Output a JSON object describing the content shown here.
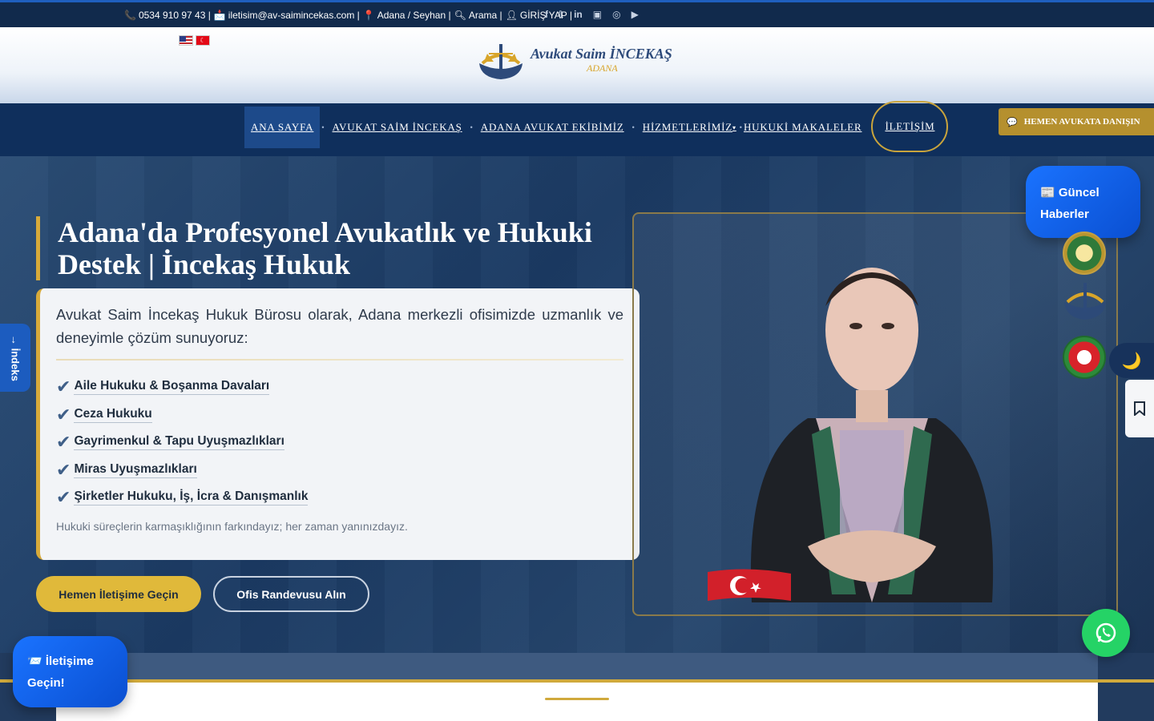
{
  "topbar": {
    "phone": "0534 910 97 43 |",
    "email": "iletisim@av-saimincekas.com |",
    "location": "Adana / Seyhan |",
    "search": "Arama |",
    "login": "GİRİŞ YAP |",
    "social_icons": [
      "facebook-icon",
      "twitter-icon",
      "linkedin-icon",
      "youtube-icon",
      "instagram-icon",
      "play-icon"
    ]
  },
  "header": {
    "logo_name": "Avukat Saim İNCEKAŞ",
    "logo_city": "ADANA",
    "languages": [
      "English",
      "Türkçe"
    ]
  },
  "nav": {
    "items": [
      "ANA SAYFA",
      "AVUKAT SAİM İNCEKAŞ",
      "ADANA AVUKAT EKİBİMİZ",
      "HİZMETLERİMİZ",
      "HUKUKİ MAKALELER",
      "İLETİŞİM"
    ],
    "consult_button": "HEMEN AVUKATA DANIŞIN"
  },
  "hero": {
    "title": "Adana'da Profesyonel Avukatlık ve Hukuki Destek | İncekaş Hukuk",
    "intro": "Avukat Saim İncekaş Hukuk Bürosu olarak, Adana merkezli ofisimizde uzmanlık ve deneyimle çözüm sunuyoruz:",
    "services": [
      "Aile Hukuku & Boşanma Davaları",
      "Ceza Hukuku",
      "Gayrimenkul & Tapu Uyuşmazlıkları",
      "Miras Uyuşmazlıkları",
      "Şirketler Hukuku, İş, İcra & Danışmanlık"
    ],
    "note": "Hukuki süreçlerin karmaşıklığının farkındayız; her zaman yanınızdayız.",
    "primary_button": "Hemen İletişime Geçin",
    "secondary_button": "Ofis Randevusu Alın"
  },
  "side": {
    "index_tab": "→ İndeks",
    "news_line1": "📰 Güncel",
    "news_line2": "Haberler",
    "contact_line1": "📨 İletişime",
    "contact_line2": "Geçin!"
  },
  "colors": {
    "navy": "#0f2f5c",
    "gold": "#d7aa3a",
    "blue_accent": "#1a73ff",
    "whatsapp": "#25d366"
  }
}
